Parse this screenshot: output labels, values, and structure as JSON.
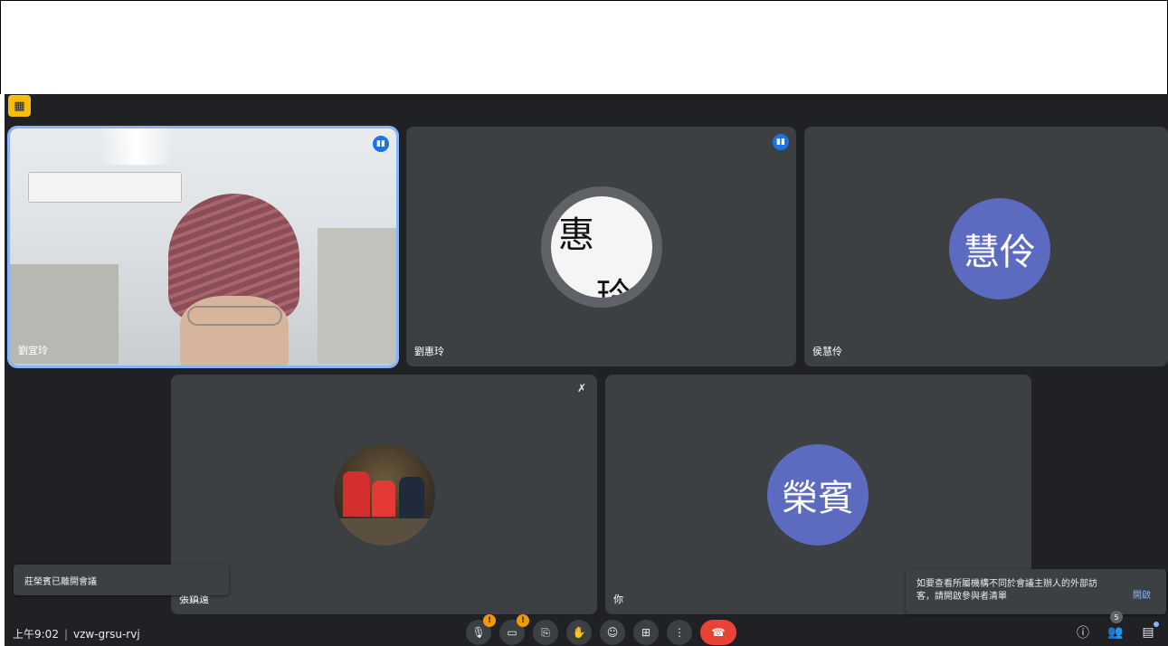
{
  "meeting": {
    "time": "上午9:02",
    "separator": "|",
    "code": "vzw-grsu-rvj"
  },
  "participants": [
    {
      "name": "劉宜玲",
      "speaking": true
    },
    {
      "name": "劉惠玲",
      "speaking": true,
      "avatar_text_1": "惠",
      "avatar_text_2": "玲"
    },
    {
      "name": "侯慧伶",
      "avatar_text": "慧伶"
    },
    {
      "name": "張鎮遠",
      "muted": true
    },
    {
      "name": "你",
      "avatar_text": "榮賓"
    }
  ],
  "toasts": {
    "left": "莊榮賓已離開會議",
    "right_message": "如要查看所屬機構不同於會議主辦人的外部訪客，請開啟參與者清單",
    "right_action": "開啟"
  },
  "badges": {
    "participant_count": "5",
    "warn": "!"
  },
  "icons": {
    "camera_off_badge": "camera-off-icon",
    "mic": "mic-icon",
    "camera": "camera-icon",
    "captions": "captions-icon",
    "raise_hand": "raise-hand-icon",
    "emoji": "emoji-icon",
    "present": "present-icon",
    "more": "more-vert-icon",
    "end_call": "end-call-icon",
    "info": "info-icon",
    "people": "people-icon",
    "chat": "chat-icon"
  },
  "colors": {
    "background": "#202124",
    "tile": "#3c4043",
    "accent_blue": "#1a73e8",
    "avatar": "#5c6bc0",
    "end_call": "#ea4335",
    "warning": "#f29900"
  }
}
